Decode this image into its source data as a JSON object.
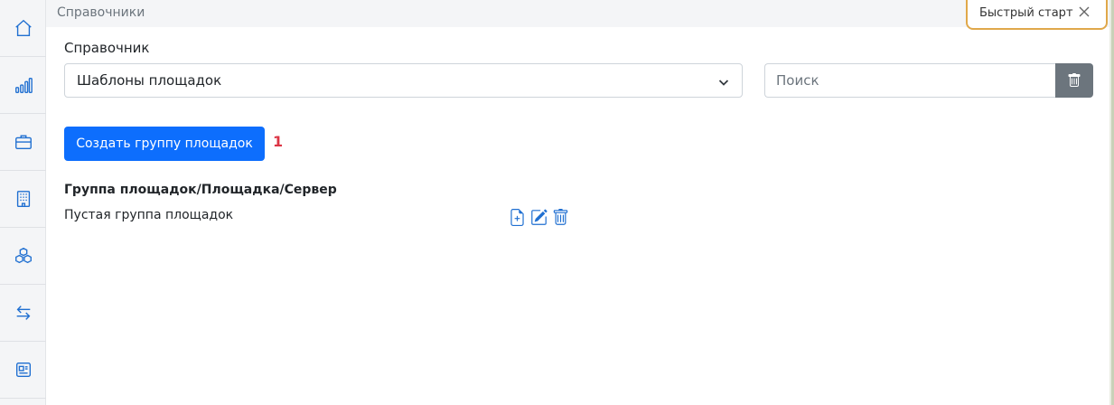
{
  "sidebar": {
    "items": [
      {
        "icon": "home-icon"
      },
      {
        "icon": "bar-chart-icon"
      },
      {
        "icon": "briefcase-icon"
      },
      {
        "icon": "building-icon"
      },
      {
        "icon": "cubes-icon"
      },
      {
        "icon": "arrows-exchange-icon"
      },
      {
        "icon": "id-card-icon"
      }
    ]
  },
  "header": {
    "title": "Справочники",
    "quick_start": "Быстрый старт"
  },
  "main": {
    "directory_label": "Справочник",
    "directory_selected": "Шаблоны площадок",
    "search_placeholder": "Поиск",
    "create_button": "Создать группу площадок",
    "create_badge": "1",
    "tree_header": "Группа площадок/Площадка/Сервер",
    "rows": [
      {
        "label": "Пустая группа площадок"
      }
    ]
  },
  "colors": {
    "accent": "#0d6efd",
    "icon": "#1f6fd1",
    "badge": "#dc3545",
    "quickstart_border": "#e0a84a"
  }
}
